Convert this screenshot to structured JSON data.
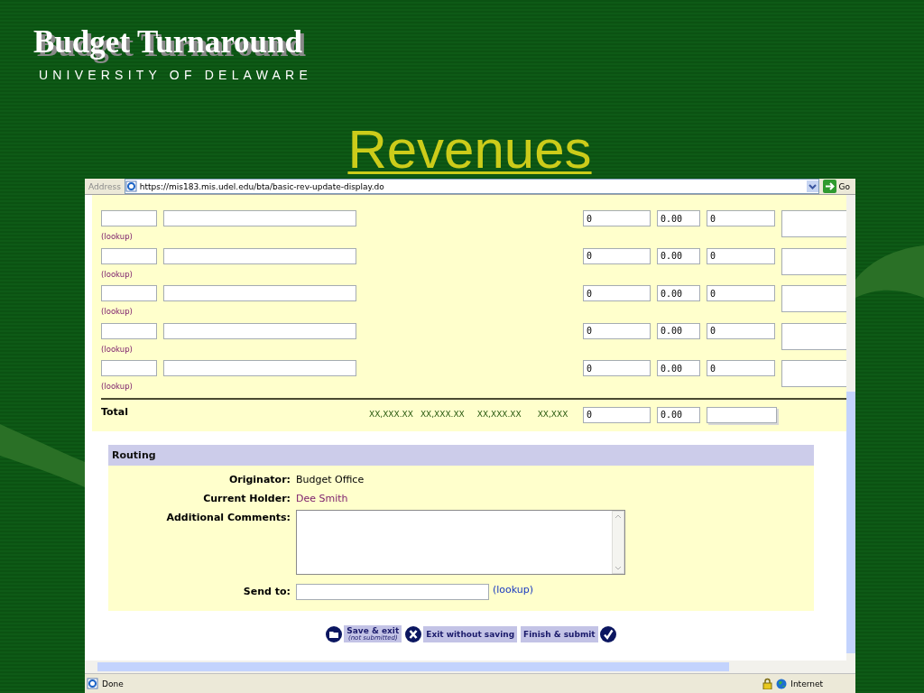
{
  "slide": {
    "logo_title": "Budget Turnaround",
    "logo_subtitle": "UNIVERSITY OF DELAWARE",
    "title": "Revenues"
  },
  "browser": {
    "address_label": "Address",
    "url": "https://mis183.mis.udel.edu/bta/basic-rev-update-display.do",
    "go_label": "Go"
  },
  "revenue_rows": [
    {
      "lookup": "(lookup)",
      "column_3": "0",
      "column_4": "0.00",
      "column_5": "0"
    },
    {
      "lookup": "(lookup)",
      "column_3": "0",
      "column_4": "0.00",
      "column_5": "0"
    },
    {
      "lookup": "(lookup)",
      "column_3": "0",
      "column_4": "0.00",
      "column_5": "0"
    },
    {
      "lookup": "(lookup)",
      "column_3": "0",
      "column_4": "0.00",
      "column_5": "0"
    },
    {
      "lookup": "(lookup)",
      "column_3": "0",
      "column_4": "0.00",
      "column_5": "0"
    }
  ],
  "total": {
    "label": "Total",
    "placeholders": [
      "XX,XXX.XX",
      "XX,XXX.XX",
      "XX,XXX.XX",
      "XX,XXX"
    ],
    "column_3": "0",
    "column_4": "0.00"
  },
  "routing": {
    "title": "Routing",
    "fields": [
      {
        "kind": "text",
        "label": "Originator:",
        "value": "Budget Office"
      },
      {
        "kind": "link",
        "label": "Current Holder:",
        "value": "Dee Smith"
      },
      {
        "kind": "textarea",
        "label": "Additional Comments:"
      },
      {
        "kind": "input",
        "label": "Send to:",
        "link": "(lookup)"
      }
    ]
  },
  "buttons": [
    {
      "kind": "save",
      "label": "Save & exit",
      "note": "(not submitted)"
    },
    {
      "kind": "exit",
      "label": "Exit without saving"
    },
    {
      "kind": "submit",
      "label": "Finish & submit"
    }
  ],
  "status_bar": {
    "text": "Done",
    "zone": "Internet"
  }
}
